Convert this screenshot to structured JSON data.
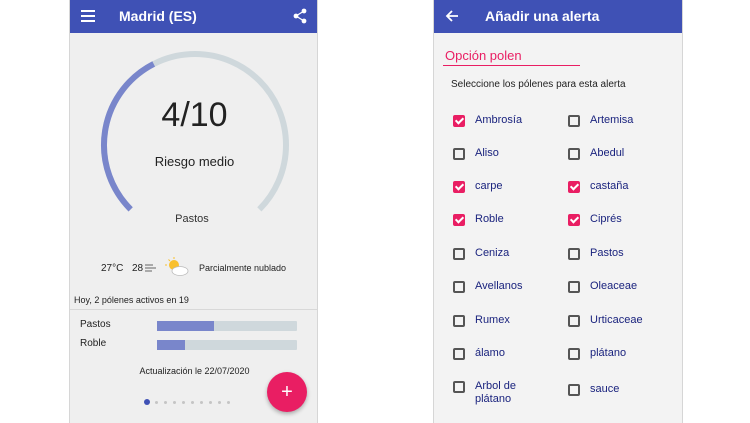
{
  "left": {
    "appbar": {
      "title": "Madrid (ES)",
      "menu_icon": "menu-icon",
      "share_icon": "share-icon"
    },
    "gauge": {
      "score": "4/10",
      "score_value": 4,
      "score_max": 10,
      "risk": "Riesgo medio",
      "label": "Pastos",
      "fill_color": "#7986cb",
      "track_color": "#cfd8dc"
    },
    "weather": {
      "temperature": "27°C",
      "wind": "28",
      "wind_icon": "wind-icon",
      "weather_icon": "partly-cloudy-icon",
      "description": "Parcialmente nublado"
    },
    "active_pollens": "Hoy, 2 pólenes activos en 19",
    "pollens": [
      {
        "name": "Pastos",
        "level": 0.41
      },
      {
        "name": "Roble",
        "level": 0.2
      }
    ],
    "updated": "Actualización le 22/07/2020",
    "fab": {
      "label": "+",
      "color": "#e91e63"
    },
    "pager": {
      "count": 10,
      "active": 0
    }
  },
  "right": {
    "appbar": {
      "title": "Añadir una alerta",
      "back_icon": "arrow-back-icon"
    },
    "option_field": {
      "label": "Opción polen"
    },
    "instruction": "Seleccione los pólenes para esta alerta",
    "items": [
      {
        "label": "Ambrosía",
        "checked": true
      },
      {
        "label": "Artemisa",
        "checked": false
      },
      {
        "label": "Aliso",
        "checked": false
      },
      {
        "label": "Abedul",
        "checked": false
      },
      {
        "label": "carpe",
        "checked": true
      },
      {
        "label": "castaña",
        "checked": true
      },
      {
        "label": "Roble",
        "checked": true
      },
      {
        "label": "Ciprés",
        "checked": true
      },
      {
        "label": "Ceniza",
        "checked": false
      },
      {
        "label": "Pastos",
        "checked": false
      },
      {
        "label": "Avellanos",
        "checked": false
      },
      {
        "label": "Oleaceae",
        "checked": false
      },
      {
        "label": "Rumex",
        "checked": false
      },
      {
        "label": "Urticaceae",
        "checked": false
      },
      {
        "label": "álamo",
        "checked": false
      },
      {
        "label": "plátano",
        "checked": false
      },
      {
        "label": "Arbol de plátano",
        "checked": false
      },
      {
        "label": "sauce",
        "checked": false
      }
    ]
  },
  "colors": {
    "primary": "#3f51b5",
    "accent": "#e91e63"
  }
}
